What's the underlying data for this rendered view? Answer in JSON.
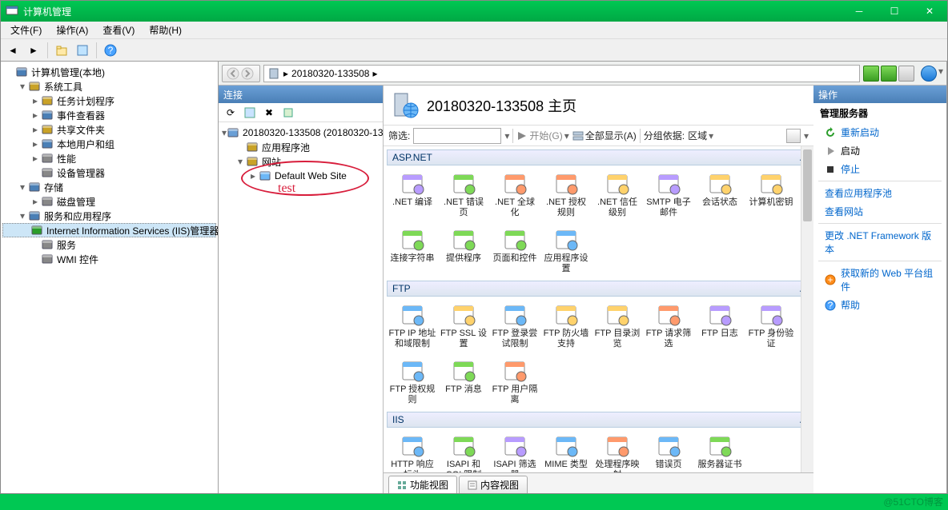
{
  "window_title": "计算机管理",
  "menu": [
    "文件(F)",
    "操作(A)",
    "查看(V)",
    "帮助(H)"
  ],
  "left_tree": [
    {
      "d": 0,
      "tw": "",
      "icon": "mgmt",
      "label": "计算机管理(本地)"
    },
    {
      "d": 1,
      "tw": "v",
      "icon": "tools",
      "label": "系统工具"
    },
    {
      "d": 2,
      "tw": ">",
      "icon": "sched",
      "label": "任务计划程序"
    },
    {
      "d": 2,
      "tw": ">",
      "icon": "event",
      "label": "事件查看器"
    },
    {
      "d": 2,
      "tw": ">",
      "icon": "share",
      "label": "共享文件夹"
    },
    {
      "d": 2,
      "tw": ">",
      "icon": "user",
      "label": "本地用户和组"
    },
    {
      "d": 2,
      "tw": ">",
      "icon": "perf",
      "label": "性能"
    },
    {
      "d": 2,
      "tw": "",
      "icon": "devmgr",
      "label": "设备管理器"
    },
    {
      "d": 1,
      "tw": "v",
      "icon": "storage",
      "label": "存储"
    },
    {
      "d": 2,
      "tw": ">",
      "icon": "disk",
      "label": "磁盘管理"
    },
    {
      "d": 1,
      "tw": "v",
      "icon": "svc",
      "label": "服务和应用程序"
    },
    {
      "d": 2,
      "tw": "",
      "icon": "iis",
      "label": "Internet Information Services (IIS)管理器",
      "sel": true
    },
    {
      "d": 2,
      "tw": "",
      "icon": "gear",
      "label": "服务"
    },
    {
      "d": 2,
      "tw": "",
      "icon": "wmi",
      "label": "WMI 控件"
    }
  ],
  "breadcrumb": [
    "20180320-133508",
    ""
  ],
  "conn_title": "连接",
  "conn_tree": [
    {
      "d": 0,
      "tw": "v",
      "icon": "srv",
      "label": "20180320-133508 (20180320-13"
    },
    {
      "d": 1,
      "tw": "",
      "icon": "pool",
      "label": "应用程序池"
    },
    {
      "d": 1,
      "tw": "v",
      "icon": "sites",
      "label": "网站"
    },
    {
      "d": 2,
      "tw": ">",
      "icon": "site",
      "label": "Default Web Site"
    }
  ],
  "annotation": "test",
  "center_title": "20180320-133508 主页",
  "filter": {
    "label": "筛选:",
    "placeholder": "",
    "begin": "开始(G)",
    "all": "全部显示(A)",
    "group": "分组依据:",
    "group_val": "区域"
  },
  "sections": {
    "aspnet": {
      "title": "ASP.NET",
      "items": [
        ".NET 编译",
        ".NET 错误页",
        ".NET 全球化",
        ".NET 授权规则",
        ".NET 信任级别",
        "SMTP 电子邮件",
        "会话状态",
        "计算机密钥",
        "连接字符串",
        "提供程序",
        "页面和控件",
        "应用程序设置"
      ]
    },
    "ftp": {
      "title": "FTP",
      "items": [
        "FTP IP 地址和域限制",
        "FTP SSL 设置",
        "FTP 登录尝试限制",
        "FTP 防火墙支持",
        "FTP 目录浏览",
        "FTP 请求筛选",
        "FTP 日志",
        "FTP 身份验证",
        "FTP 授权规则",
        "FTP 消息",
        "FTP 用户隔离"
      ]
    },
    "iis": {
      "title": "IIS",
      "items": [
        "HTTP 响应标头",
        "ISAPI 和 CGI 限制",
        "ISAPI 筛选器",
        "MIME 类型",
        "处理程序映射",
        "错误页",
        "服务器证书"
      ]
    }
  },
  "tabs": {
    "features": "功能视图",
    "content": "内容视图"
  },
  "actions": {
    "title": "操作",
    "sub": "管理服务器",
    "items1": [
      {
        "icon": "restart",
        "label": "重新启动",
        "c": "link"
      },
      {
        "icon": "play",
        "label": "启动",
        "c": "black"
      },
      {
        "icon": "stop",
        "label": "停止",
        "c": "link"
      }
    ],
    "items2": [
      {
        "label": "查看应用程序池"
      },
      {
        "label": "查看网站"
      }
    ],
    "items3": [
      {
        "label": "更改 .NET Framework 版本"
      }
    ],
    "items4": [
      {
        "icon": "new",
        "label": "获取新的 Web 平台组件"
      },
      {
        "icon": "help",
        "label": "帮助"
      }
    ]
  },
  "watermark": "@51CTO博客"
}
